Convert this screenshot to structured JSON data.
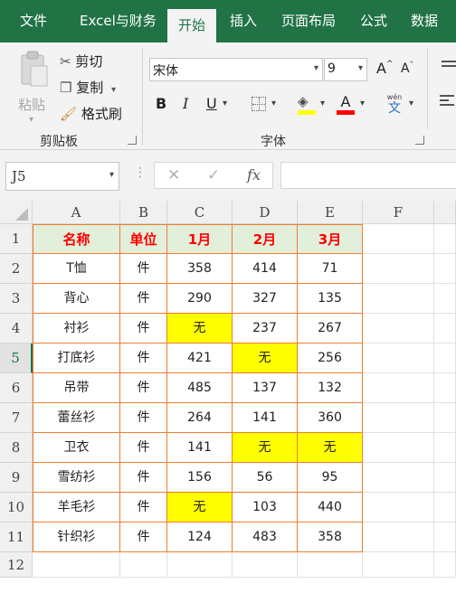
{
  "menu": {
    "tabs": [
      "文件",
      "Excel与财务",
      "开始",
      "插入",
      "页面布局",
      "公式",
      "数据"
    ],
    "active_index": 2
  },
  "ribbon": {
    "clipboard": {
      "paste_label": "粘贴",
      "cut_label": "剪切",
      "copy_label": "复制",
      "format_painter_label": "格式刷",
      "group_label": "剪贴板"
    },
    "font": {
      "font_name": "宋体",
      "font_size": "9",
      "bold": "B",
      "italic": "I",
      "underline": "U",
      "font_color_glyph": "A",
      "phonetic_top": "wén",
      "phonetic_char": "文",
      "grow_glyph": "A",
      "shrink_glyph": "A",
      "group_label": "字体"
    },
    "colors": {
      "accent": "#217346",
      "highlight": "#ffff00",
      "font_color": "#ff0000"
    }
  },
  "formula_bar": {
    "name_box": "J5",
    "fx_label": "fx",
    "formula": ""
  },
  "sheet": {
    "columns": [
      "A",
      "B",
      "C",
      "D",
      "E",
      "F"
    ],
    "rows": [
      "1",
      "2",
      "3",
      "4",
      "5",
      "6",
      "7",
      "8",
      "9",
      "10",
      "11",
      "12"
    ],
    "selected_row": "5",
    "header_row": [
      "名称",
      "单位",
      "1月",
      "2月",
      "3月"
    ],
    "data": [
      [
        "T恤",
        "件",
        "358",
        "414",
        "71"
      ],
      [
        "背心",
        "件",
        "290",
        "327",
        "135"
      ],
      [
        "衬衫",
        "件",
        "无",
        "237",
        "267"
      ],
      [
        "打底衫",
        "件",
        "421",
        "无",
        "256"
      ],
      [
        "吊带",
        "件",
        "485",
        "137",
        "132"
      ],
      [
        "蕾丝衫",
        "件",
        "264",
        "141",
        "360"
      ],
      [
        "卫衣",
        "件",
        "141",
        "无",
        "无"
      ],
      [
        "雪纺衫",
        "件",
        "156",
        "56",
        "95"
      ],
      [
        "羊毛衫",
        "件",
        "无",
        "103",
        "440"
      ],
      [
        "针织衫",
        "件",
        "124",
        "483",
        "358"
      ]
    ]
  }
}
